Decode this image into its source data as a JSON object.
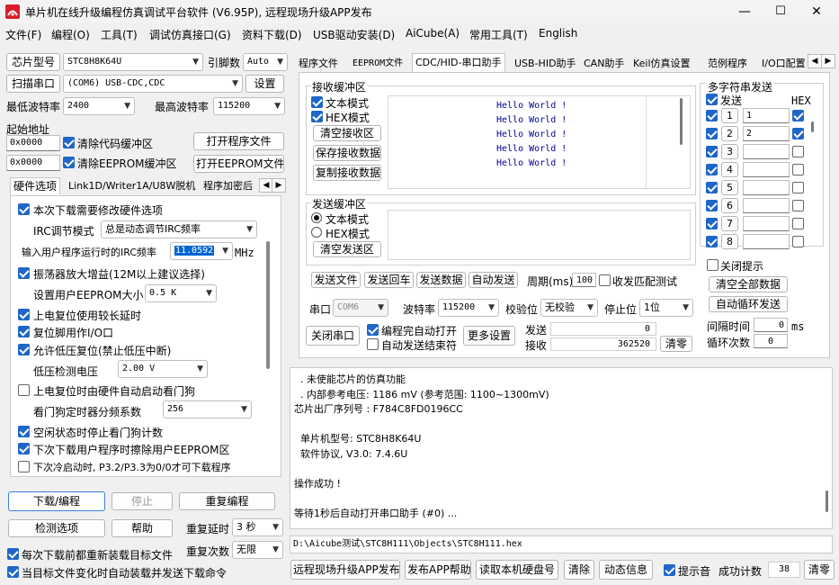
{
  "window": {
    "title": "单片机在线升级编程仿真调试平台软件 (V6.95P), 远程现场升级APP发布",
    "minimize": "—",
    "maximize": "☐",
    "close": "✕"
  },
  "menu": [
    "文件(F)",
    "编程(O)",
    "工具(T)",
    "调试仿真接口(G)",
    "资料下载(D)",
    "USB驱动安装(D)",
    "AiCube(A)",
    "常用工具(T)",
    "English"
  ],
  "left": {
    "chip_label": "芯片型号",
    "chip_value": "STC8H8K64U",
    "pins_label": "引脚数",
    "pins_value": "Auto",
    "scan_label": "扫描串口",
    "port_value": "(COM6) USB-CDC,CDC",
    "settings_label": "设置",
    "min_baud_label": "最低波特率",
    "min_baud_value": "2400",
    "max_baud_label": "最高波特率",
    "max_baud_value": "115200",
    "start_addr_label": "起始地址",
    "addr1": "0x0000",
    "clear_code_label": "清除代码缓冲区",
    "open_prog_label": "打开程序文件",
    "addr2": "0x0000",
    "clear_eeprom_label": "清除EEPROM缓冲区",
    "open_eeprom_label": "打开EEPROM文件",
    "tabs": [
      "硬件选项",
      "Link1D/Writer1A/U8W脱机",
      "程序加密后"
    ],
    "hw": {
      "opt1": "本次下载需要修改硬件选项",
      "irc_mode_label": "IRC调节模式",
      "irc_mode_value": "总是动态调节IRC频率",
      "irc_freq_label": "输入用户程序运行时的IRC频率",
      "irc_freq_value": "11.0592",
      "irc_unit": "MHz",
      "opt_osc": "振荡器放大增益(12M以上建议选择)",
      "eeprom_size_label": "设置用户EEPROM大小",
      "eeprom_size_value": "0.5 K",
      "opt_por": "上电复位使用较长延时",
      "opt_reset_io": "复位脚用作I/O口",
      "opt_lvr": "允许低压复位(禁止低压中断)",
      "lvd_label": "低压检测电压",
      "lvd_value": "2.00 V",
      "opt_wdt": "上电复位时由硬件自动启动看门狗",
      "wdt_div_label": "看门狗定时器分频系数",
      "wdt_div_value": "256",
      "opt_idle_wdt": "空闲状态时停止看门狗计数",
      "opt_erase_eeprom": "下次下载用户程序时擦除用户EEPROM区",
      "opt_cold": "下次冷启动时, P3.2/P3.3为0/0才可下载程序"
    },
    "download_label": "下载/编程",
    "stop_label": "停止",
    "reprog_label": "重复编程",
    "detect_label": "检测选项",
    "help_label": "帮助",
    "repeat_delay_label": "重复延时",
    "repeat_delay_value": "3 秒",
    "reload_label": "每次下载前都重新装载目标文件",
    "repeat_count_label": "重复次数",
    "repeat_count_value": "无限",
    "autosend_label": "当目标文件变化时自动装载并发送下载命令"
  },
  "right": {
    "tabs": [
      "程序文件",
      "EEPROM文件",
      "CDC/HID-串口助手",
      "USB-HID助手",
      "CAN助手",
      "Keil仿真设置",
      "范例程序",
      "I/O口配置"
    ],
    "recv": {
      "group_label": "接收缓冲区",
      "text_mode": "文本模式",
      "hex_mode": "HEX模式",
      "clear_recv": "清空接收区",
      "save_recv": "保存接收数据",
      "copy_recv": "复制接收数据",
      "lines": [
        "Hello World !",
        "Hello World !",
        "Hello World !",
        "Hello World !",
        "Hello World !"
      ]
    },
    "send": {
      "group_label": "发送缓冲区",
      "text_mode": "文本模式",
      "hex_mode": "HEX模式",
      "clear_send": "清空发送区",
      "send_file": "发送文件",
      "send_return": "发送回车",
      "send_data": "发送数据",
      "auto_send": "自动发送",
      "period_label": "周期(ms)",
      "period_value": "100",
      "match_label": "收发匹配测试"
    },
    "multi": {
      "group_label": "多字符串发送",
      "send_label": "发送",
      "hex_label": "HEX",
      "rows": [
        {
          "num": "1",
          "value": "1"
        },
        {
          "num": "2",
          "value": "2"
        },
        {
          "num": "3",
          "value": ""
        },
        {
          "num": "4",
          "value": ""
        },
        {
          "num": "5",
          "value": ""
        },
        {
          "num": "6",
          "value": ""
        },
        {
          "num": "7",
          "value": ""
        },
        {
          "num": "8",
          "value": ""
        }
      ],
      "close_tip": "关闭提示",
      "clear_all": "清空全部数据",
      "auto_loop": "自动循环发送",
      "interval_label": "间隔时间",
      "interval_value": "0",
      "interval_unit": "ms",
      "loop_label": "循环次数",
      "loop_value": "0"
    },
    "port": {
      "port_label": "串口",
      "port_value": "COM6",
      "baud_label": "波特率",
      "baud_value": "115200",
      "parity_label": "校验位",
      "parity_value": "无校验",
      "stop_label": "停止位",
      "stop_value": "1位",
      "close_port": "关闭串口",
      "auto_open": "编程完自动打开",
      "auto_send_end": "自动发送结束符",
      "more": "更多设置",
      "sent_label": "发送",
      "sent_value": "0",
      "recv_label": "接收",
      "recv_value": "362520",
      "clear": "清零"
    },
    "log": [
      {
        "text": "  . 未使能芯片的仿真功能",
        "mono": false
      },
      {
        "text": "  . 内部参考电压: 1186 mV (参考范围: 1100~1300mV)",
        "mono": false
      },
      {
        "text": "芯片出厂序列号 : F784C8FD0196CC",
        "mono": false
      },
      {
        "text": "",
        "mono": false
      },
      {
        "text": "  单片机型号: STC8H8K64U",
        "mono": false
      },
      {
        "text": "  软件协议, V3.0: 7.4.6U",
        "mono": false
      },
      {
        "text": "",
        "mono": false
      },
      {
        "text": "操作成功 !",
        "mono": false
      },
      {
        "text": "",
        "mono": false
      },
      {
        "text": "等待1秒后自动打开串口助手 (#0) ...",
        "mono": false
      }
    ],
    "file_path": "D:\\Aicube测试\\STC8H111\\Objects\\STC8H111.hex",
    "bottom": {
      "remote": "远程现场升级APP发布",
      "publish_help": "发布APP帮助",
      "read_disk": "读取本机硬盘号",
      "clear": "清除",
      "dynamic": "动态信息",
      "beep": "提示音",
      "success_label": "成功计数",
      "success_value": "38",
      "reset": "清零"
    }
  }
}
